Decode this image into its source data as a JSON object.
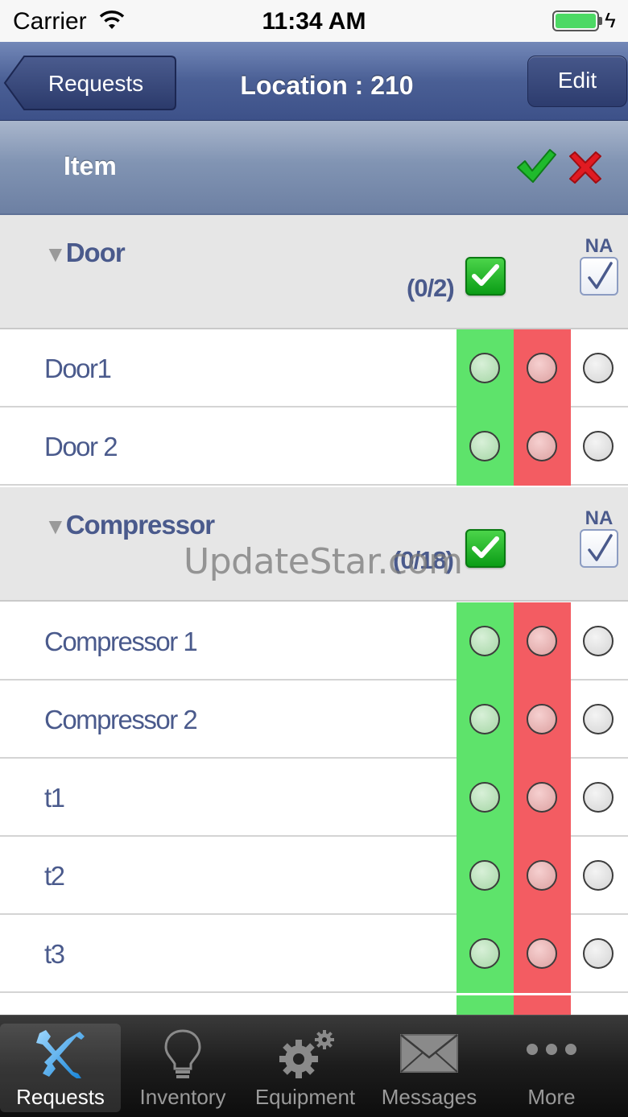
{
  "status_bar": {
    "carrier": "Carrier",
    "time": "11:34 AM"
  },
  "nav": {
    "back_label": "Requests",
    "title": "Location : 210",
    "edit_label": "Edit"
  },
  "header": {
    "title": "Item"
  },
  "watermark": "UpdateStar.com",
  "colors": {
    "ok": "#5ee36b",
    "fail": "#f35c62",
    "text": "#4a5a8c",
    "nav": "#4a5f95"
  },
  "sections": [
    {
      "title": "Door",
      "count": "(0/2)",
      "na_label": "NA",
      "items": [
        "Door1",
        "Door 2"
      ]
    },
    {
      "title": "Compressor",
      "count": "(0/18)",
      "na_label": "NA",
      "items": [
        "Compressor 1",
        "Compressor 2",
        "t1",
        "t2",
        "t3"
      ]
    }
  ],
  "tabs": [
    {
      "label": "Requests",
      "icon": "tools-icon",
      "active": true
    },
    {
      "label": "Inventory",
      "icon": "lightbulb-icon",
      "active": false
    },
    {
      "label": "Equipment",
      "icon": "gears-icon",
      "active": false
    },
    {
      "label": "Messages",
      "icon": "envelope-icon",
      "active": false
    },
    {
      "label": "More",
      "icon": "more-dots-icon",
      "active": false
    }
  ]
}
